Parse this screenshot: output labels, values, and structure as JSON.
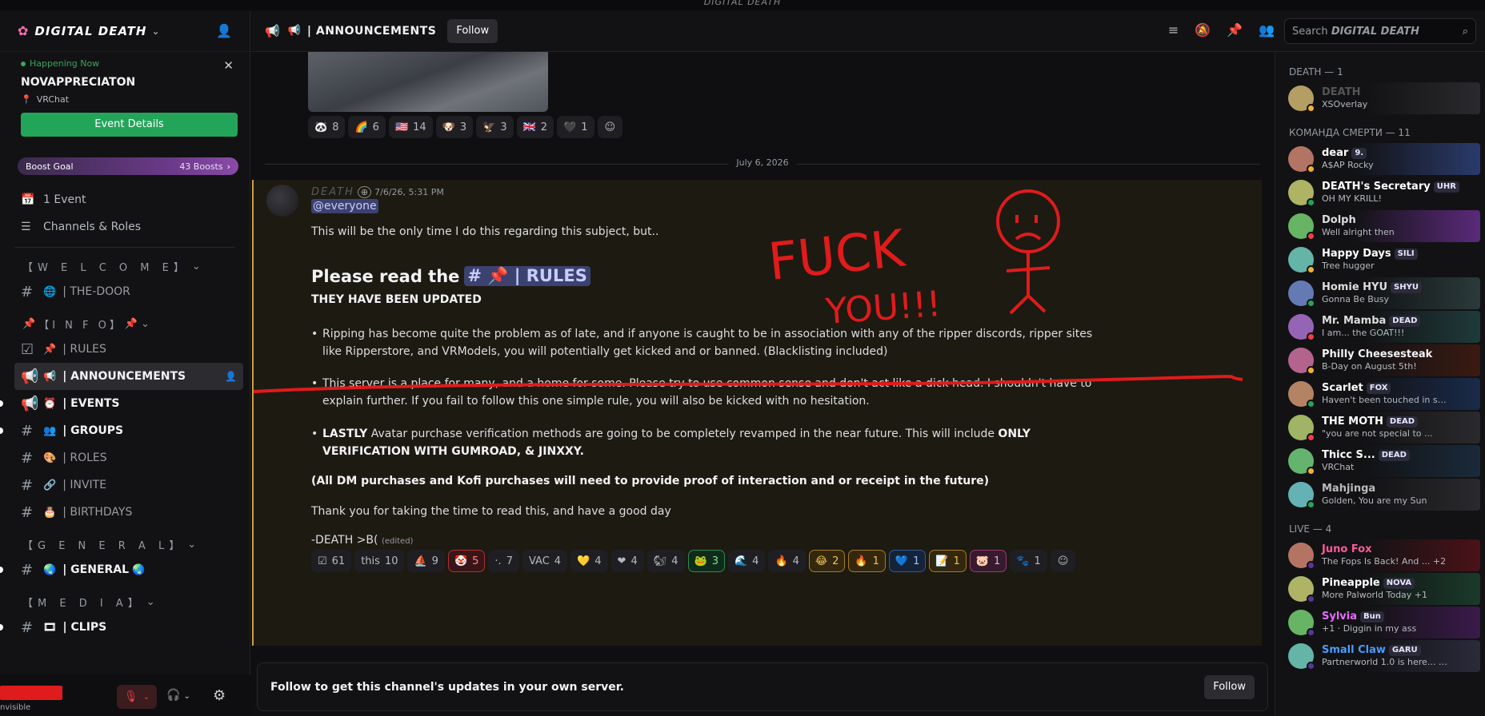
{
  "window": {
    "title": "DIGITAL DEATH"
  },
  "server": {
    "name": "DIGITAL DEATH"
  },
  "event": {
    "status": "Happening Now",
    "name": "NOVAPPRECIATON",
    "location": "VRChat",
    "button": "Event Details"
  },
  "boost": {
    "label": "Boost Goal",
    "count": "43 Boosts"
  },
  "menu": {
    "events": "1 Event",
    "channels_roles": "Channels & Roles"
  },
  "categories": {
    "welcome": "【W E L C O M E】",
    "info": "【I N F O】",
    "general": "【G E N E R A L】",
    "media": "【M E D I A】"
  },
  "channels": {
    "the_door": "| THE-DOOR",
    "rules": "| RULES",
    "announcements": "| ANNOUNCEMENTS",
    "events": "| EVENTS",
    "groups": "| GROUPS",
    "roles": "| ROLES",
    "invite": "| INVITE",
    "birthdays": "| BIRTHDAYS",
    "general": "| GENERAL",
    "clips": "| CLIPS"
  },
  "user": {
    "status": "nvisible"
  },
  "header": {
    "channel_title": "| ANNOUNCEMENTS",
    "follow": "Follow",
    "search_placeholder": "Search",
    "search_server": "DIGITAL DEATH"
  },
  "reactions_top": [
    {
      "emoji": "🐼",
      "count": "8"
    },
    {
      "emoji": "🌈",
      "count": "6"
    },
    {
      "emoji": "🇺🇸",
      "count": "14"
    },
    {
      "emoji": "🐶",
      "count": "3"
    },
    {
      "emoji": "🦅",
      "count": "3"
    },
    {
      "emoji": "🇬🇧",
      "count": "2"
    },
    {
      "emoji": "🖤",
      "count": "1"
    }
  ],
  "date_divider": "July 6, 2026",
  "message": {
    "author": "DEATH",
    "timestamp": "7/6/26, 5:31 PM",
    "mention": "@everyone",
    "intro": "This will be the only time I do this regarding this subject, but..",
    "heading": "Please read the",
    "heading_channel": "# 📌 | RULES",
    "updated": "THEY HAVE BEEN UPDATED",
    "bullet1": "Ripping has become quite the problem as of late, and if anyone is caught to be in association with any of the ripper discords, ripper sites like Ripperstore, and VRModels, you will potentially get kicked and or banned. (Blacklisting included)",
    "bullet2": "This server is a place for many, and a home for some. Please try to use common sense and don't act like a dick head. I shouldn't have to explain further. If you fail to follow this one simple rule, you will also be kicked with no hesitation.",
    "bullet3_bold": "LASTLY",
    "bullet3": " Avatar purchase verification methods are going to be completely revamped in the near future. This will include ",
    "bullet3_bold2": "ONLY VERIFICATION WITH GUMROAD, & JINXXY.",
    "note": "(All DM purchases and Kofi purchases will need to provide proof of interaction and or receipt in the future)",
    "thanks": "Thank you for taking the time to read this, and have a good day",
    "sign": "-DEATH >B(",
    "edited": "(edited)"
  },
  "reactions_bottom": [
    {
      "emoji": "☑",
      "count": "61",
      "style": ""
    },
    {
      "emoji": "this",
      "count": "10",
      "style": ""
    },
    {
      "emoji": "⛵",
      "count": "9",
      "style": ""
    },
    {
      "emoji": "🤡",
      "count": "5",
      "style": "red"
    },
    {
      "emoji": "·.",
      "count": "7",
      "style": ""
    },
    {
      "emoji": "VAC",
      "count": "4",
      "style": ""
    },
    {
      "emoji": "💛",
      "count": "4",
      "style": ""
    },
    {
      "emoji": "❤",
      "count": "4",
      "style": ""
    },
    {
      "emoji": "🐿",
      "count": "4",
      "style": ""
    },
    {
      "emoji": "🐸",
      "count": "3",
      "style": "green"
    },
    {
      "emoji": "🌊",
      "count": "4",
      "style": ""
    },
    {
      "emoji": "🔥",
      "count": "4",
      "style": ""
    },
    {
      "emoji": "😂",
      "count": "2",
      "style": "gold"
    },
    {
      "emoji": "🔥",
      "count": "1",
      "style": "gold"
    },
    {
      "emoji": "💙",
      "count": "1",
      "style": "blue"
    },
    {
      "emoji": "📝",
      "count": "1",
      "style": "gold"
    },
    {
      "emoji": "🐷",
      "count": "1",
      "style": "pink"
    },
    {
      "emoji": "🐾",
      "count": "1",
      "style": ""
    }
  ],
  "annotation": {
    "word1": "FUCK",
    "word2": "YOU!!!"
  },
  "followbar": {
    "text": "Follow to get this channel's updates in your own server.",
    "button": "Follow"
  },
  "members": {
    "cat_death": "DEATH — 1",
    "cat_team": "КОМАНДА СМЕРТИ — 11",
    "cat_live": "LIVE — 4",
    "death": [
      {
        "name": "DEATH",
        "status": "XSOverlay",
        "tag": "",
        "color": "#555",
        "bg": "linear-gradient(90deg,#121214 40%,#2a2a2e)"
      }
    ],
    "team": [
      {
        "name": "dear",
        "status": "A$AP Rocky",
        "tag": "9.",
        "color": "#fff",
        "bg": "linear-gradient(90deg,#121214 35%,#2a3a6a)"
      },
      {
        "name": "DEATH's Secretary",
        "status": "OH MY KRILL!",
        "tag": "UHR",
        "color": "#fff",
        "bg": "#121214"
      },
      {
        "name": "Dolph",
        "status": "Well alright then",
        "tag": "",
        "color": "#ddd",
        "bg": "linear-gradient(90deg,#121214 35%,#5a2a7a)"
      },
      {
        "name": "Happy Days",
        "status": "Tree hugger",
        "tag": "SILI",
        "color": "#fff",
        "bg": "#121214"
      },
      {
        "name": "Homie HYU",
        "status": "Gonna Be Busy",
        "tag": "SHYU",
        "color": "#ddd",
        "bg": "linear-gradient(90deg,#121214 40%,#2a3a3a)"
      },
      {
        "name": "Mr. Mamba",
        "status": "I am... the GOAT!!!",
        "tag": "DEAD",
        "color": "#ddd",
        "bg": "linear-gradient(90deg,#121214 40%,#1f3a3a)"
      },
      {
        "name": "Philly Cheesesteak",
        "status": "B-Day on August 5th!",
        "tag": "",
        "color": "#f2f3f5",
        "bg": "linear-gradient(90deg,#121214 40%,#3a1a12)"
      },
      {
        "name": "Scarlet",
        "status": "Haven't been touched in so...",
        "tag": "FOX",
        "color": "#fff",
        "bg": "linear-gradient(90deg,#121214 40%,#1a2a4a)"
      },
      {
        "name": "THE MOTH",
        "status": "\"you are not special to ...",
        "tag": "DEAD",
        "color": "#fff",
        "bg": "linear-gradient(90deg,#121214 40%,#2a2a2e)"
      },
      {
        "name": "Thicc S...",
        "status": "VRChat",
        "tag": "DEAD",
        "color": "#fff",
        "bg": "linear-gradient(90deg,#121214 40%,#1a2a3a)"
      },
      {
        "name": "Mahjinga",
        "status": "Golden, You are my Sun",
        "tag": "",
        "color": "#bbb",
        "bg": "linear-gradient(90deg,#121214 40%,#2a2a2e)"
      }
    ],
    "live": [
      {
        "name": "Juno Fox",
        "status": "The Fops Is Back! And ... +2",
        "tag": "",
        "color": "#ff5a9a",
        "bg": "linear-gradient(90deg,#121214 40%,#4a1218)"
      },
      {
        "name": "Pineapple",
        "status": "More Palworld Today +1",
        "tag": "NOVA",
        "color": "#fff",
        "bg": "linear-gradient(90deg,#121214 40%,#1a3a2a)"
      },
      {
        "name": "Sylvia",
        "status": "+1 · Diggin in my ass",
        "tag": "Bun",
        "color": "#e56bff",
        "bg": "linear-gradient(90deg,#121214 40%,#3a1a4a)"
      },
      {
        "name": "Small Claw",
        "status": "Partnerworld 1.0 is here... +1",
        "tag": "GARU",
        "color": "#4a9aff",
        "bg": "linear-gradient(90deg,#121214 40%,#2a2a3a)"
      }
    ]
  },
  "colors": {
    "accent": "#5865f2",
    "green": "#23a559",
    "gold": "#c9a038",
    "annotation": "#e01b1b"
  }
}
